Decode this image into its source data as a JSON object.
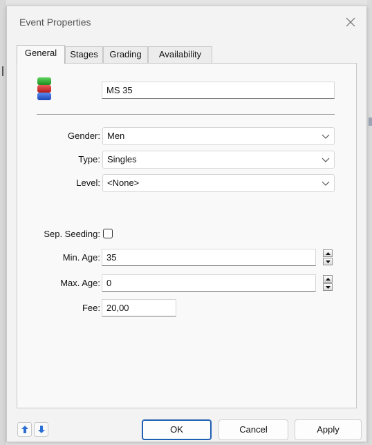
{
  "window": {
    "title": "Event Properties"
  },
  "tabs": [
    {
      "label": "General",
      "active": true
    },
    {
      "label": "Stages",
      "active": false
    },
    {
      "label": "Grading",
      "active": false
    },
    {
      "label": "Availability",
      "active": false
    }
  ],
  "general": {
    "event_icon": "color-stack-icon",
    "name": "MS 35",
    "gender": {
      "label": "Gender:",
      "value": "Men"
    },
    "type": {
      "label": "Type:",
      "value": "Singles"
    },
    "level": {
      "label": "Level:",
      "value": "<None>"
    },
    "sep_seeding": {
      "label": "Sep. Seeding:",
      "checked": false
    },
    "min_age": {
      "label": "Min. Age:",
      "value": "35"
    },
    "max_age": {
      "label": "Max. Age:",
      "value": "0"
    },
    "fee": {
      "label": "Fee:",
      "value": "20,00"
    }
  },
  "footer": {
    "ok_label": "OK",
    "cancel_label": "Cancel",
    "apply_label": "Apply"
  },
  "colors": {
    "accent": "#1f5fb3",
    "nav_arrow": "#2b6fd6"
  }
}
